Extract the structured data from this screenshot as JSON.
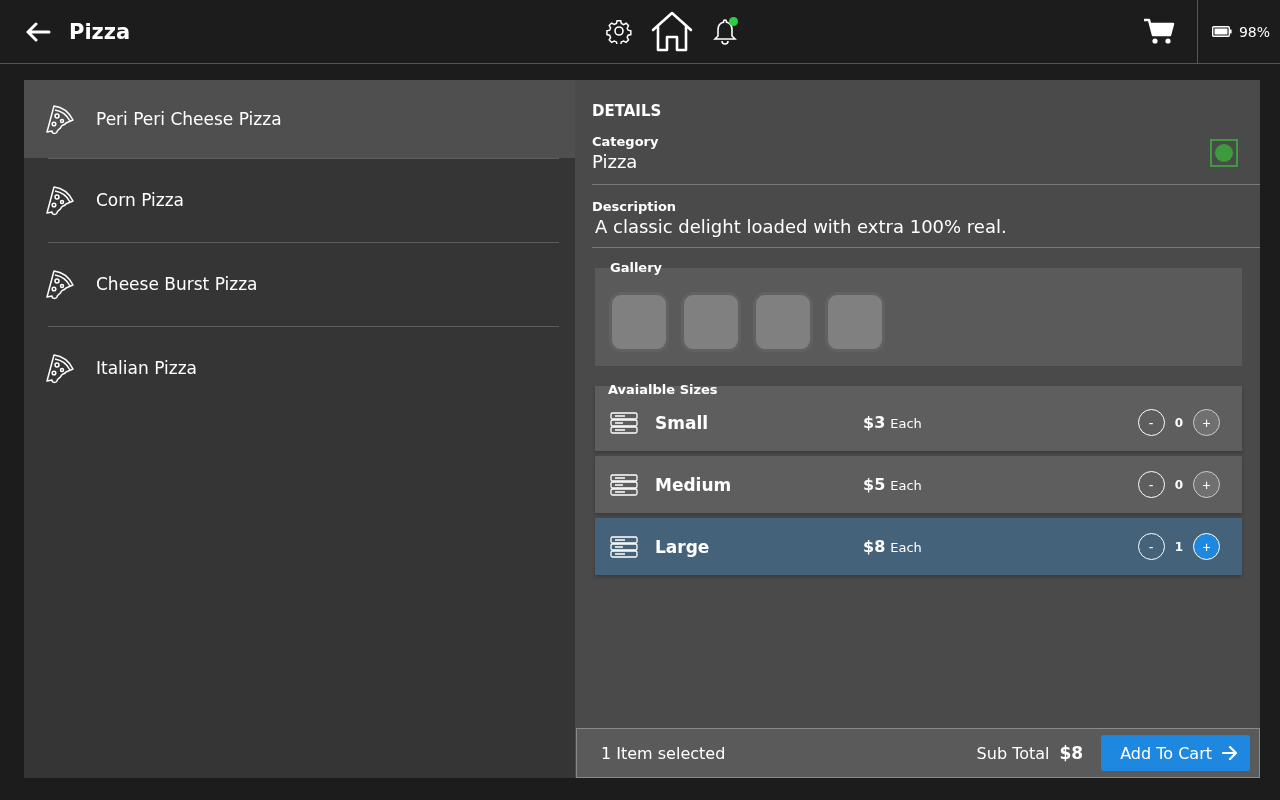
{
  "header": {
    "title": "Pizza",
    "notifications": {
      "unread": true
    },
    "battery": "98%"
  },
  "menu": [
    {
      "name": "Peri Peri Cheese Pizza",
      "selected": true
    },
    {
      "name": "Corn Pizza",
      "selected": false
    },
    {
      "name": "Cheese Burst Pizza",
      "selected": false
    },
    {
      "name": "Italian Pizza",
      "selected": false
    }
  ],
  "details": {
    "heading": "DETAILS",
    "category_label": "Category",
    "category": "Pizza",
    "description_label": "Description",
    "description": "A classic delight loaded with extra 100% real.",
    "gallery": {
      "label": "Gallery",
      "images": [
        {
          "kind": "placeholder"
        },
        {
          "kind": "placeholder"
        },
        {
          "kind": "placeholder"
        },
        {
          "kind": "placeholder"
        }
      ]
    },
    "sizes_label": "Avaialble Sizes",
    "sizes": [
      {
        "name": "Small",
        "price": "$3",
        "unit": "Each",
        "decrease": "-",
        "quantity": "0",
        "increase": "+",
        "selected": false
      },
      {
        "name": "Medium",
        "price": "$5",
        "unit": "Each",
        "decrease": "-",
        "quantity": "0",
        "increase": "+",
        "selected": false
      },
      {
        "name": "Large",
        "price": "$8",
        "unit": "Each",
        "decrease": "-",
        "quantity": "1",
        "increase": "+",
        "selected": true
      }
    ]
  },
  "footer": {
    "selection": "1 Item selected",
    "subtotal_label": "Sub Total",
    "subtotal": "$8",
    "button": "Add To Cart"
  }
}
